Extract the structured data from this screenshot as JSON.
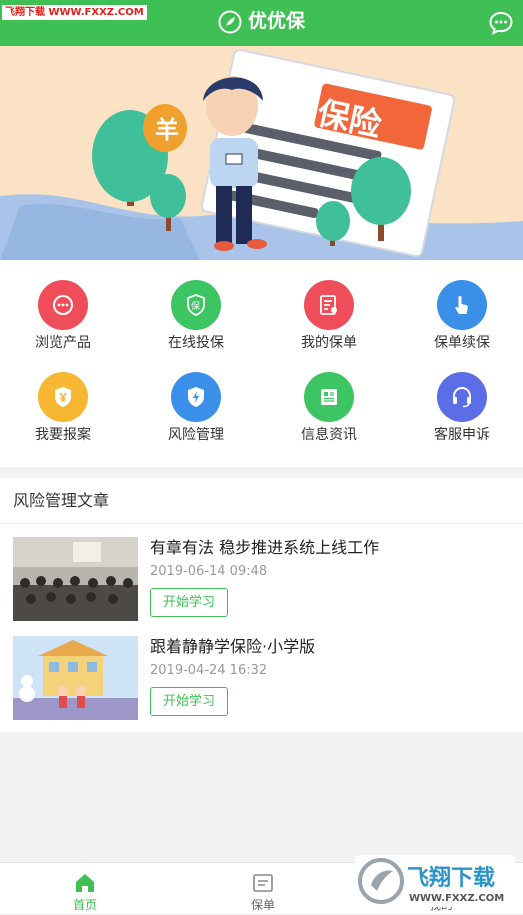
{
  "watermark": "飞翔下载 WWW.FXXZ.COM",
  "header": {
    "title": "优优保",
    "logo_icon": "leaf-logo-icon",
    "chat_icon": "chat-bubble-icon"
  },
  "banner": {
    "sign_text": "保险",
    "bag_symbol": "羊"
  },
  "menu": [
    {
      "label": "浏览产品",
      "icon": "more-dots-icon",
      "color": "#ef4d5a"
    },
    {
      "label": "在线投保",
      "icon": "shield-bao-icon",
      "color": "#3dc463"
    },
    {
      "label": "我的保单",
      "icon": "policy-doc-icon",
      "color": "#ef4d5a"
    },
    {
      "label": "保单续保",
      "icon": "hand-tap-icon",
      "color": "#3a8fe8"
    },
    {
      "label": "我要报案",
      "icon": "shield-yen-icon",
      "color": "#f7b733"
    },
    {
      "label": "风险管理",
      "icon": "shield-bolt-icon",
      "color": "#3a8fe8"
    },
    {
      "label": "信息资讯",
      "icon": "news-icon",
      "color": "#3dc463"
    },
    {
      "label": "客服申诉",
      "icon": "headset-icon",
      "color": "#5b6ee8"
    }
  ],
  "articles_section": {
    "title": "风险管理文章",
    "items": [
      {
        "title": "有章有法 稳步推进系统上线工作",
        "time": "2019-06-14 09:48",
        "button": "开始学习"
      },
      {
        "title": "跟着静静学保险·小学版",
        "time": "2019-04-24 16:32",
        "button": "开始学习"
      }
    ]
  },
  "bottom_nav": [
    {
      "label": "首页",
      "icon": "home-icon",
      "active": true
    },
    {
      "label": "保单",
      "icon": "policy-list-icon",
      "active": false
    },
    {
      "label": "我的",
      "icon": "profile-icon",
      "active": false
    }
  ],
  "corner_watermark": "飞翔下载",
  "corner_watermark_url": "WWW.FXXZ.COM",
  "colors": {
    "brand": "#3fc055",
    "text": "#333333",
    "muted": "#999999"
  }
}
